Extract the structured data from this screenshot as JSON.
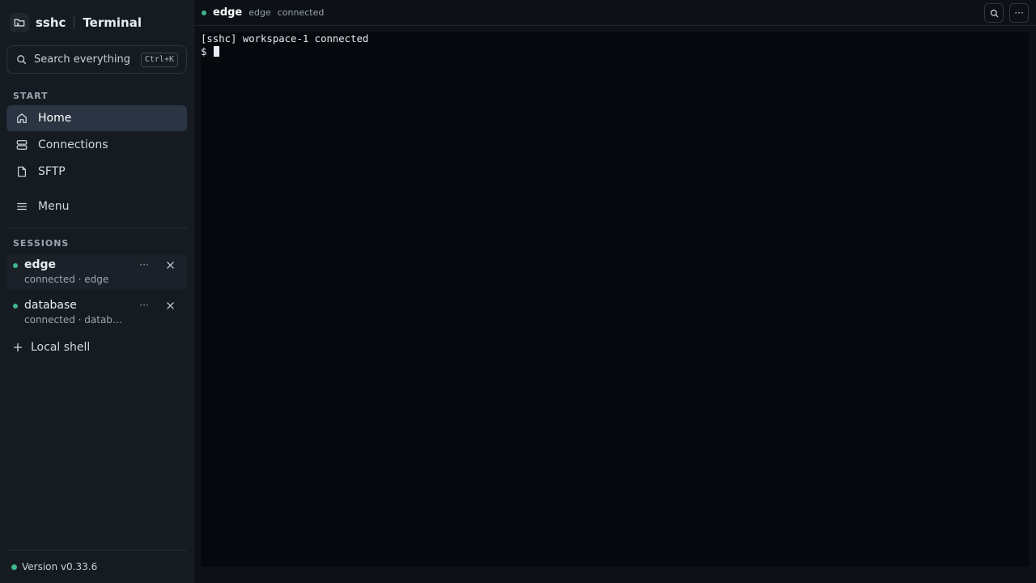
{
  "brand": {
    "name": "sshc",
    "title": "Terminal"
  },
  "search": {
    "placeholder": "Search everything",
    "shortcut": "Ctrl+K"
  },
  "start": {
    "label": "START",
    "items": [
      {
        "label": "Home",
        "icon": "home-icon",
        "active": true
      },
      {
        "label": "Connections",
        "icon": "server-icon"
      },
      {
        "label": "SFTP",
        "icon": "file-icon"
      }
    ],
    "menu_label": "Menu"
  },
  "sessions": {
    "label": "SESSIONS",
    "items": [
      {
        "name": "edge",
        "sub": "connected · edge",
        "status": "connected",
        "active": true,
        "more": "···"
      },
      {
        "name": "database",
        "sub": "connected · database",
        "status": "connected",
        "more": "···"
      }
    ],
    "local_shell": "Local shell"
  },
  "footer": {
    "version": "Version v0.33.6"
  },
  "topbar": {
    "name": "edge",
    "host": "edge",
    "status": "connected",
    "more": "···"
  },
  "terminal": {
    "lines": [
      "[sshc] workspace-1 connected",
      "$ "
    ]
  },
  "colors": {
    "accent_green": "#3fb68b",
    "active_bg": "#2a3442"
  }
}
